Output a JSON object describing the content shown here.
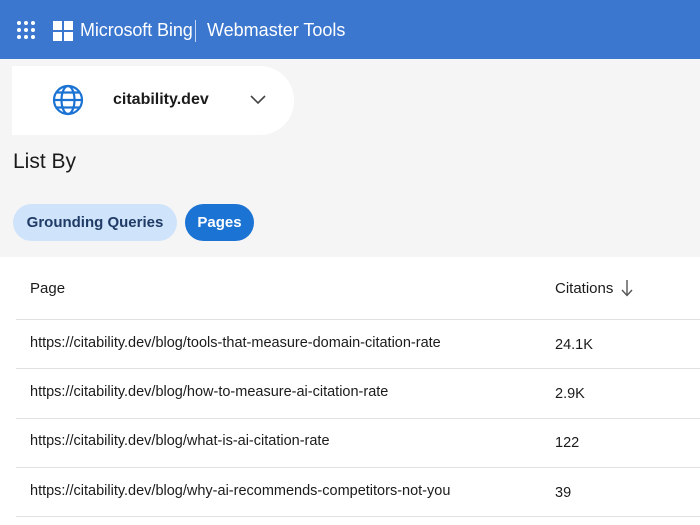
{
  "header": {
    "brand": "Microsoft Bing",
    "product": "Webmaster Tools",
    "bg_color": "#3b76cf",
    "icons": [
      "app-launcher-icon",
      "microsoft-logo-icon"
    ]
  },
  "site_picker": {
    "site": "citability.dev",
    "icons": [
      "globe-icon",
      "chevron-down-icon"
    ]
  },
  "list_by": {
    "heading": "List By",
    "tabs": [
      {
        "label": "Grounding Queries",
        "selected": false
      },
      {
        "label": "Pages",
        "selected": true
      }
    ]
  },
  "table": {
    "columns": [
      "Page",
      "Citations"
    ],
    "sort_column": "Citations",
    "sort_direction": "descending",
    "rows": [
      {
        "page": "https://citability.dev/blog/tools-that-measure-domain-citation-rate",
        "citations": "24.1K"
      },
      {
        "page": "https://citability.dev/blog/how-to-measure-ai-citation-rate",
        "citations": "2.9K"
      },
      {
        "page": "https://citability.dev/blog/what-is-ai-citation-rate",
        "citations": "122"
      },
      {
        "page": "https://citability.dev/blog/why-ai-recommends-competitors-not-you",
        "citations": "39"
      }
    ]
  },
  "colors": {
    "accent": "#1b73d3",
    "tab_unselected_bg": "#cfe3fa"
  }
}
